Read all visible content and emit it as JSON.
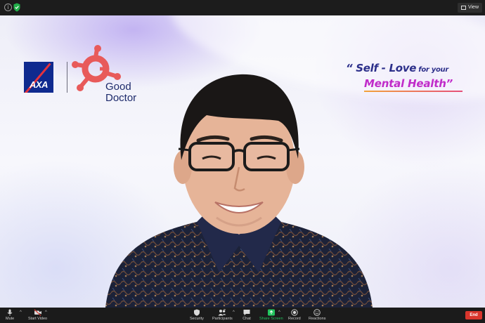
{
  "topbar": {
    "info_icon": "i",
    "view_label": "View"
  },
  "logos": {
    "axa_text": "AXA",
    "good_doctor_line1": "Good",
    "good_doctor_line2": "Doctor"
  },
  "campaign": {
    "line1_a": "“ Self - Love",
    "line1_b": " for your",
    "line2": "Mental Health”"
  },
  "toolbar": {
    "mute_label": "Mute",
    "start_video_label": "Start Video",
    "security_label": "Security",
    "participants_label": "Participants",
    "participants_count": "2",
    "chat_label": "Chat",
    "share_screen_label": "Share Screen",
    "record_label": "Record",
    "reactions_label": "Reactions",
    "end_label": "End"
  },
  "colors": {
    "share_green": "#22c55e",
    "end_red": "#d9352c",
    "axa_blue": "#0f2a8f",
    "good_doctor_coral": "#e85a5a"
  }
}
